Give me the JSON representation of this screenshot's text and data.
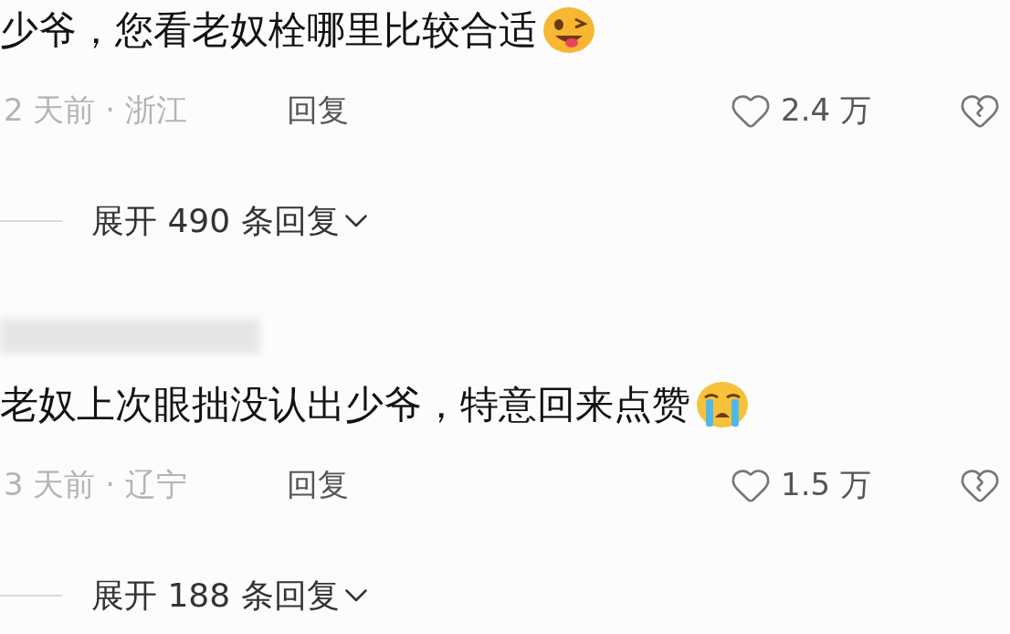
{
  "comments": [
    {
      "blurred_author": false,
      "text": "少爷，您看老奴栓哪里比较合适",
      "kind": "wink",
      "meta": "2 天前 · 浙江",
      "reply": "回复",
      "likes": "2.4 万",
      "expand": "展开 490 条回复"
    },
    {
      "blurred_author": true,
      "text": "老奴上次眼拙没认出少爷，特意回来点赞",
      "kind": "cry",
      "meta": "3 天前 · 辽宁",
      "reply": "回复",
      "likes": "1.5 万",
      "expand": "展开 188 条回复"
    }
  ]
}
